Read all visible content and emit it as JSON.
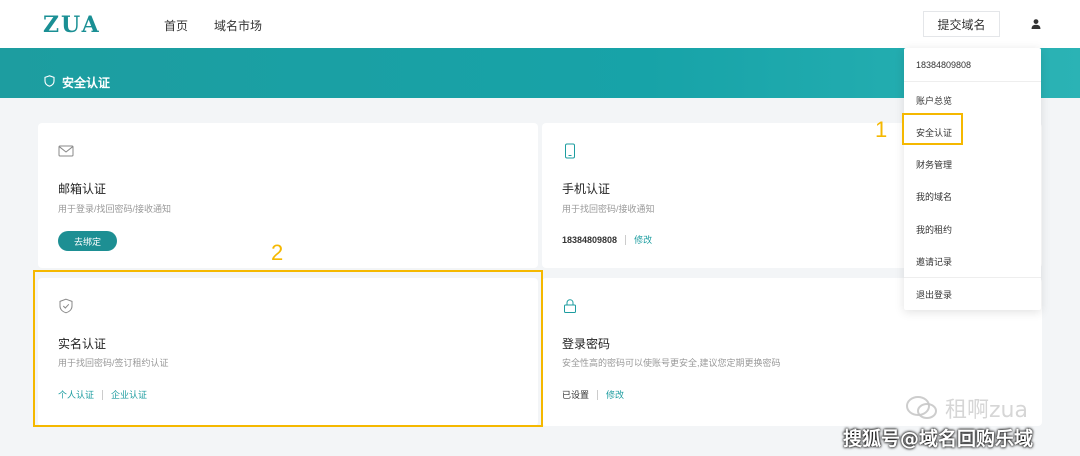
{
  "header": {
    "logo": "ZUA",
    "nav": [
      "首页",
      "域名市场"
    ],
    "submit_label": "提交域名"
  },
  "banner": {
    "title": "安全认证"
  },
  "cards": {
    "email": {
      "title": "邮箱认证",
      "desc": "用于登录/找回密码/接收通知",
      "button": "去绑定"
    },
    "phone": {
      "title": "手机认证",
      "desc": "用于找回密码/接收通知",
      "value": "18384809808",
      "action": "修改"
    },
    "realname": {
      "title": "实名认证",
      "desc": "用于找回密码/签订租约认证",
      "action1": "个人认证",
      "action2": "企业认证"
    },
    "password": {
      "title": "登录密码",
      "desc": "安全性高的密码可以使账号更安全,建议您定期更换密码",
      "status": "已设置",
      "action": "修改"
    }
  },
  "dropdown": {
    "phone": "18384809808",
    "items": [
      "账户总览",
      "安全认证",
      "财务管理",
      "我的域名",
      "我的租约",
      "邀请记录",
      "退出登录"
    ]
  },
  "annotations": {
    "one": "1",
    "two": "2"
  },
  "watermark": {
    "top": "租啊zua",
    "bottom": "搜狐号@域名回购乐域"
  },
  "colors": {
    "primary": "#1d9da0",
    "highlight": "#f5b800"
  }
}
